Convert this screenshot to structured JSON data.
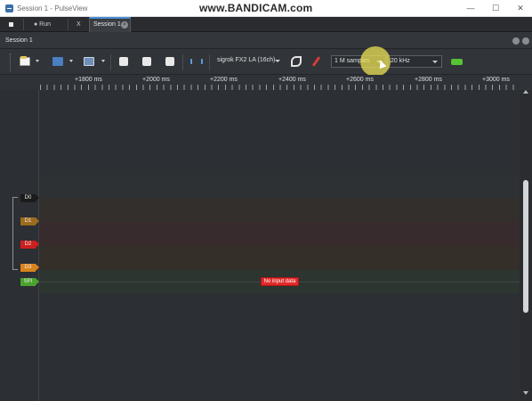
{
  "window": {
    "title": "Session 1 - PulseView",
    "watermark": "www.BANDICAM.com",
    "minimize_glyph": "—",
    "maximize_glyph": "☐",
    "close_glyph": "✕"
  },
  "tabbar": {
    "run_label": "● Run",
    "x_label": "X",
    "active_tab_label": "Session 1",
    "close_glyph": "×"
  },
  "session": {
    "title": "Session 1"
  },
  "toolbar": {
    "device_label": "sigrok FX2 LA (16ch)",
    "samples_value": "1 M samples",
    "rate_value": "20 kHz",
    "icons": [
      "new-session-icon",
      "open-icon",
      "save-as-icon",
      "zoom-in-icon",
      "zoom-out-icon",
      "zoom-fit-icon",
      "cursor-icon",
      "configure-icon",
      "probe-icon",
      "run-icon"
    ]
  },
  "ruler": {
    "ticks": [
      "+1800 ms",
      "+2000 ms",
      "+2200 ms",
      "+2400 ms",
      "+2600 ms",
      "+2800 ms",
      "+3000 ms"
    ]
  },
  "channels": [
    {
      "label": "D0",
      "color": "#1b1b1b"
    },
    {
      "label": "D1",
      "color": "#9c6b1d"
    },
    {
      "label": "D2",
      "color": "#cc1f1f"
    },
    {
      "label": "D3",
      "color": "#d9831c"
    },
    {
      "label": "SPI",
      "color": "#4aa32c"
    }
  ],
  "status": {
    "no_input": "No input data"
  }
}
